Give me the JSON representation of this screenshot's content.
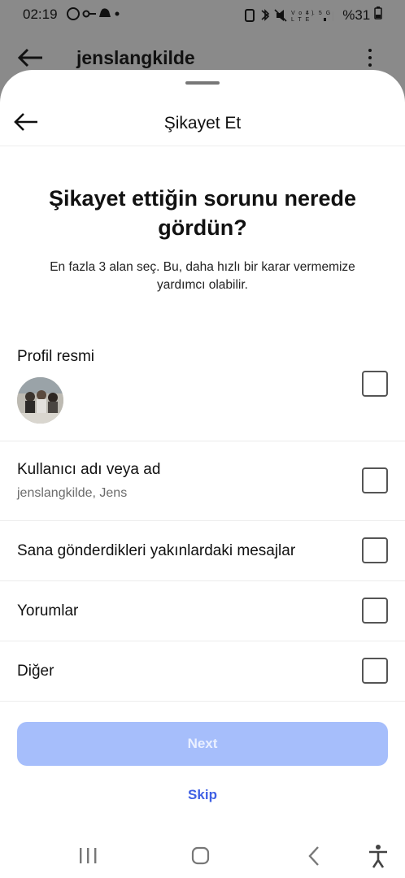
{
  "status_bar": {
    "time": "02:19",
    "left_icons": [
      "whatsapp-icon",
      "key-icon",
      "snapchat-icon",
      "dot-icon"
    ],
    "right_icons_text": "VoLTE 4.5G",
    "battery": "%31"
  },
  "background_header": {
    "username": "jenslangkilde"
  },
  "sheet": {
    "title": "Şikayet Et",
    "question": "Şikayet ettiğin sorunu nerede gördün?",
    "subtitle": "En fazla 3 alan seç. Bu, daha hızlı bir karar vermemize yardımcı olabilir.",
    "options": [
      {
        "label": "Profil resmi",
        "sub": "",
        "checked": false
      },
      {
        "label": "Kullanıcı adı veya ad",
        "sub": "jenslangkilde, Jens",
        "checked": false
      },
      {
        "label": "Sana gönderdikleri yakınlardaki mesajlar",
        "sub": "",
        "checked": false
      },
      {
        "label": "Yorumlar",
        "sub": "",
        "checked": false
      },
      {
        "label": "Diğer",
        "sub": "",
        "checked": false
      }
    ],
    "next_label": "Next",
    "skip_label": "Skip"
  },
  "colors": {
    "accent": "#3f60e4",
    "next_disabled": "#a6befb"
  },
  "nav_bar": [
    "recents-icon",
    "home-icon",
    "back-icon",
    "accessibility-icon"
  ]
}
